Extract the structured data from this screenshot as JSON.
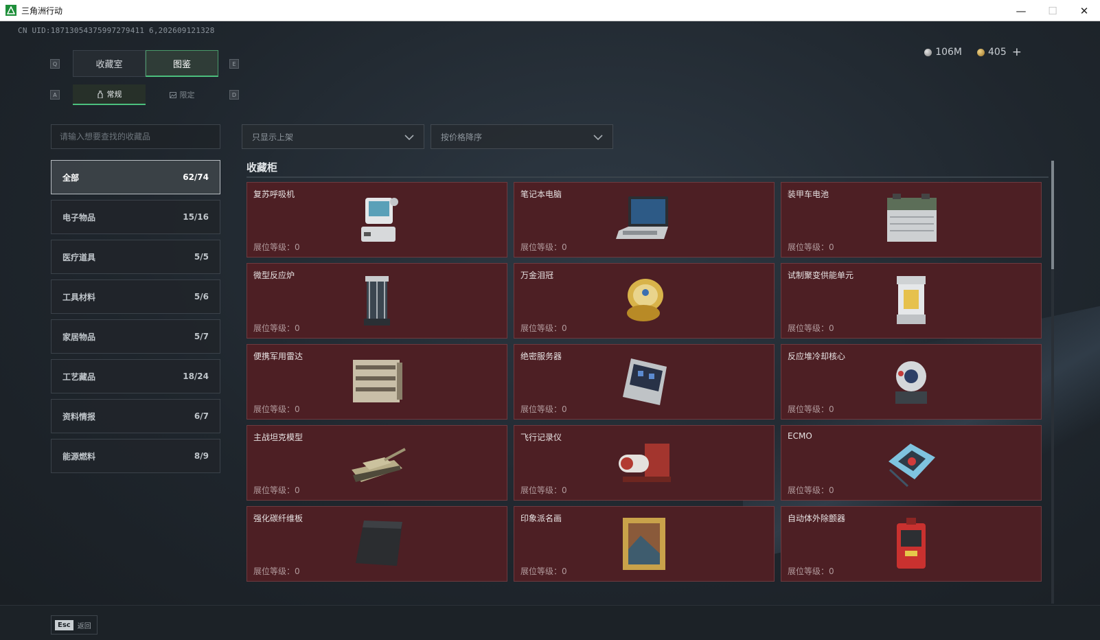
{
  "window": {
    "title": "三角洲行动",
    "minimize": "—",
    "maximize": "☐",
    "close": "✕"
  },
  "uid": "CN UID:18713054375997279411 6,202609121328",
  "currency": {
    "silver": "106M",
    "gold": "405",
    "plus": "+"
  },
  "hotkeys": {
    "prev_tab": "Q",
    "next_tab": "E",
    "prev_sub": "A",
    "next_sub": "D"
  },
  "tabs": [
    {
      "label": "收藏室",
      "active": false
    },
    {
      "label": "图鉴",
      "active": true
    }
  ],
  "subtabs": [
    {
      "label": "常规",
      "icon": "bottle-icon",
      "active": true
    },
    {
      "label": "限定",
      "icon": "picture-icon",
      "active": false
    }
  ],
  "search": {
    "placeholder": "请输入想要查找的收藏品",
    "value": ""
  },
  "filters": {
    "availability": "只显示上架",
    "sort": "按价格降序"
  },
  "categories": [
    {
      "label": "全部",
      "count": "62/74",
      "active": true
    },
    {
      "label": "电子物品",
      "count": "15/16"
    },
    {
      "label": "医疗道具",
      "count": "5/5"
    },
    {
      "label": "工具材料",
      "count": "5/6"
    },
    {
      "label": "家居物品",
      "count": "5/7"
    },
    {
      "label": "工艺藏品",
      "count": "18/24"
    },
    {
      "label": "资料情报",
      "count": "6/7"
    },
    {
      "label": "能源燃料",
      "count": "8/9"
    }
  ],
  "section": {
    "title": "收藏柜"
  },
  "level_label": "展位等级：0",
  "items": [
    {
      "name": "复苏呼吸机",
      "icon": "ventilator-icon"
    },
    {
      "name": "笔记本电脑",
      "icon": "laptop-icon"
    },
    {
      "name": "装甲车电池",
      "icon": "battery-icon"
    },
    {
      "name": "微型反应炉",
      "icon": "reactor-icon"
    },
    {
      "name": "万金泪冠",
      "icon": "jeweled-egg-icon"
    },
    {
      "name": "试制聚变供能单元",
      "icon": "fusion-cell-icon"
    },
    {
      "name": "便携军用雷达",
      "icon": "radar-icon"
    },
    {
      "name": "绝密服务器",
      "icon": "server-icon"
    },
    {
      "name": "反应堆冷却核心",
      "icon": "cooling-core-icon"
    },
    {
      "name": "主战坦克模型",
      "icon": "tank-icon"
    },
    {
      "name": "飞行记录仪",
      "icon": "flight-recorder-icon"
    },
    {
      "name": "ECMO",
      "icon": "ecmo-icon"
    },
    {
      "name": "强化碳纤维板",
      "icon": "carbon-plate-icon"
    },
    {
      "name": "印象派名画",
      "icon": "painting-icon"
    },
    {
      "name": "自动体外除颤器",
      "icon": "defibrillator-icon"
    }
  ],
  "footer": {
    "esc_key": "Esc",
    "esc_label": "返回"
  },
  "colors": {
    "card_bg": "#4d1f24",
    "accent_green": "#4cc07e"
  }
}
